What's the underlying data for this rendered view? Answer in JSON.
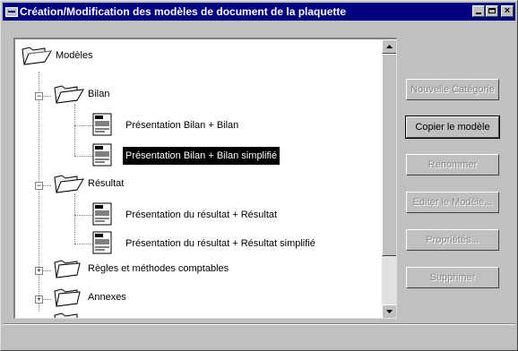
{
  "window": {
    "title": "Création/Modification des modèles de document de la plaquette",
    "close_glyph": "×"
  },
  "tree": {
    "root": "Modèles",
    "bilan": "Bilan",
    "bilan_docs": [
      "Présentation Bilan + Bilan",
      "Présentation Bilan + Bilan simplifié"
    ],
    "resultat": "Résultat",
    "resultat_docs": [
      "Présentation du résultat + Résultat",
      "Présentation du résultat + Résultat simplifié"
    ],
    "regles": "Règles et méthodes comptables",
    "annexes": "Annexes",
    "expanded_glyph": "−",
    "collapsed_glyph": "+",
    "selected_item": "Présentation Bilan + Bilan simplifié"
  },
  "buttons": {
    "nouvelle_categorie": "Nouvelle Catégorie",
    "copier": "Copier le modèle",
    "renommer": "Renommer",
    "editer": "Editer le Modèle...",
    "proprietes": "Propriétés...",
    "supprimer": "Supprimer"
  },
  "icons": {
    "app": "app-window-icon",
    "folder": "open-folder-icon",
    "document": "document-icon",
    "scroll_up": "scroll-up-arrow-icon",
    "scroll_down": "scroll-down-arrow-icon"
  },
  "colors": {
    "titlebar": "#000080",
    "face": "#c0c0c0",
    "selection": "#000000",
    "disabled_text": "#888888"
  }
}
